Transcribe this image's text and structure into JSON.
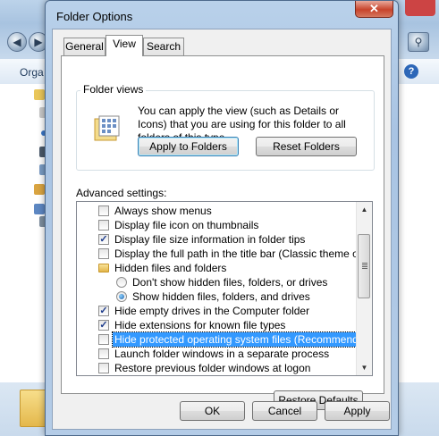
{
  "background": {
    "organize_label": "Orga",
    "help_icon": "help-icon"
  },
  "dialog": {
    "title": "Folder Options",
    "close_glyph": "✕",
    "tabs": [
      {
        "label": "General",
        "active": false
      },
      {
        "label": "View",
        "active": true
      },
      {
        "label": "Search",
        "active": false
      }
    ],
    "folder_views": {
      "group_label": "Folder views",
      "description": "You can apply the view (such as Details or Icons) that you are using for this folder to all folders of this type.",
      "apply_button": "Apply to Folders",
      "reset_button": "Reset Folders"
    },
    "advanced_label": "Advanced settings:",
    "advanced_items": [
      {
        "label": "Always show menus",
        "kind": "checkbox",
        "checked": false
      },
      {
        "label": "Display file icon on thumbnails",
        "kind": "checkbox",
        "checked": false
      },
      {
        "label": "Display file size information in folder tips",
        "kind": "checkbox",
        "checked": true
      },
      {
        "label": "Display the full path in the title bar (Classic theme only)",
        "kind": "checkbox",
        "checked": false
      },
      {
        "label": "Hidden files and folders",
        "kind": "folder"
      },
      {
        "label": "Don't show hidden files, folders, or drives",
        "kind": "radio",
        "checked": false
      },
      {
        "label": "Show hidden files, folders, and drives",
        "kind": "radio",
        "checked": true
      },
      {
        "label": "Hide empty drives in the Computer folder",
        "kind": "checkbox",
        "checked": true
      },
      {
        "label": "Hide extensions for known file types",
        "kind": "checkbox",
        "checked": true
      },
      {
        "label": "Hide protected operating system files (Recommended)",
        "kind": "checkbox",
        "checked": false,
        "selected": true
      },
      {
        "label": "Launch folder windows in a separate process",
        "kind": "checkbox",
        "checked": false
      },
      {
        "label": "Restore previous folder windows at logon",
        "kind": "checkbox",
        "checked": false
      }
    ],
    "restore_defaults_button": "Restore Defaults",
    "ok_button": "OK",
    "cancel_button": "Cancel",
    "apply_button": "Apply",
    "check_glyph": "✓"
  }
}
